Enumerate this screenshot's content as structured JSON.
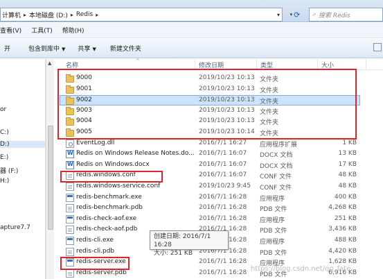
{
  "address_bar": {
    "crumbs": [
      "计算机",
      "本地磁盘 (D:)",
      "Redis"
    ],
    "search_placeholder": "搜索 Redis"
  },
  "menu": [
    "查看(V)",
    "工具(T)",
    "帮助(H)"
  ],
  "toolbar": {
    "open": "开",
    "include_in_library": "包含到库中",
    "share": "共享",
    "new_folder": "新建文件夹"
  },
  "nav_items": [
    "or",
    "C:)",
    "D:)",
    "E:)",
    "器 (F:)",
    "H:)",
    "apture7.7"
  ],
  "columns": {
    "name": "名称",
    "modified": "修改日期",
    "type": "类型",
    "size": "大小"
  },
  "files": [
    {
      "name": "9000",
      "modified": "2019/10/23 10:13",
      "type": "文件夹",
      "size": "",
      "icon": "folder-icon"
    },
    {
      "name": "9001",
      "modified": "2019/10/23 10:13",
      "type": "文件夹",
      "size": "",
      "icon": "folder-icon"
    },
    {
      "name": "9002",
      "modified": "2019/10/23 10:13",
      "type": "文件夹",
      "size": "",
      "icon": "folder-icon",
      "selected": true
    },
    {
      "name": "9003",
      "modified": "2019/10/23 10:13",
      "type": "文件夹",
      "size": "",
      "icon": "folder-icon"
    },
    {
      "name": "9004",
      "modified": "2019/10/23 10:13",
      "type": "文件夹",
      "size": "",
      "icon": "folder-icon"
    },
    {
      "name": "9005",
      "modified": "2019/10/23 10:14",
      "type": "文件夹",
      "size": "",
      "icon": "folder-icon"
    },
    {
      "name": "EventLog.dll",
      "modified": "2016/7/1 16:27",
      "type": "应用程序扩展",
      "size": "1 KB",
      "icon": "dll-icon"
    },
    {
      "name": "Redis on Windows Release Notes.do...",
      "modified": "2016/7/1 16:07",
      "type": "DOCX 文档",
      "size": "13 KB",
      "icon": "doc-icon"
    },
    {
      "name": "Redis on Windows.docx",
      "modified": "2016/7/1 16:07",
      "type": "DOCX 文档",
      "size": "17 KB",
      "icon": "doc-icon"
    },
    {
      "name": "redis.windows.conf",
      "modified": "2016/7/1 16:07",
      "type": "CONF 文件",
      "size": "48 KB",
      "icon": "file-icon"
    },
    {
      "name": "redis.windows-service.conf",
      "modified": "2019/10/23 9:45",
      "type": "CONF 文件",
      "size": "48 KB",
      "icon": "file-icon"
    },
    {
      "name": "redis-benchmark.exe",
      "modified": "2016/7/1 16:28",
      "type": "应用程序",
      "size": "400 KB",
      "icon": "exe-icon"
    },
    {
      "name": "redis-benchmark.pdb",
      "modified": "2016/7/1 16:28",
      "type": "PDB 文件",
      "size": "4,268 KB",
      "icon": "file-icon"
    },
    {
      "name": "redis-check-aof.exe",
      "modified": "2016/7/1 16:28",
      "type": "应用程序",
      "size": "251 KB",
      "icon": "exe-icon"
    },
    {
      "name": "redis-check-aof.pdb",
      "modified": "2016/7/1 16:28",
      "type": "PDB 文件",
      "size": "3,436 KB",
      "icon": "file-icon"
    },
    {
      "name": "redis-cli.exe",
      "modified": "2016/7/1 16:28",
      "type": "应用程序",
      "size": "488 KB",
      "icon": "exe-icon"
    },
    {
      "name": "redis-cli.pdb",
      "modified": "2016/7/1 16:28",
      "type": "PDB 文件",
      "size": "4,420 KB",
      "icon": "file-icon"
    },
    {
      "name": "redis-server.exe",
      "modified": "2016/7/1 16:28",
      "type": "应用程序",
      "size": "1,628 KB",
      "icon": "exe-icon"
    },
    {
      "name": "redis-server.pdb",
      "modified": "2016/7/1 16:28",
      "type": "PDB 文件",
      "size": "6,916 KB",
      "icon": "file-icon"
    }
  ],
  "tooltip": {
    "created": "创建日期: 2016/7/1 16:28",
    "size": "大小: 251 KB"
  },
  "watermark": "https://blog.csdn.net/qq_fate",
  "colors": {
    "highlight_red": "#e0242b",
    "selection_blue": "#cce4fb"
  }
}
